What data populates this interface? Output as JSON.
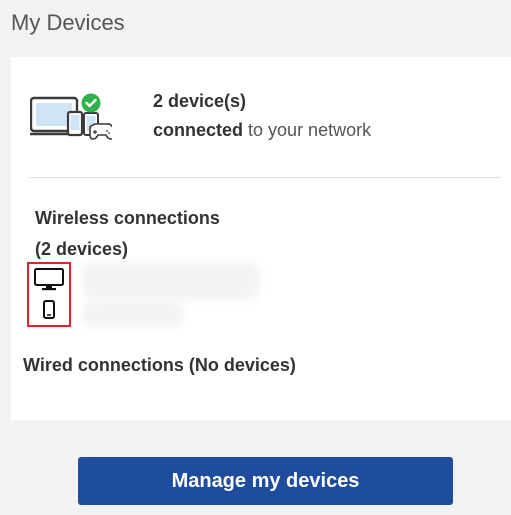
{
  "page_title": "My Devices",
  "summary": {
    "count_text": "2 device(s)",
    "status_bold": "connected",
    "status_rest": " to your network",
    "illustration_icon": "devices-connected-icon",
    "check_color": "#2eb24a"
  },
  "wireless": {
    "heading_line1": "Wireless connections",
    "heading_line2": "(2 devices)",
    "devices": [
      {
        "icon": "monitor-icon"
      },
      {
        "icon": "phone-icon"
      }
    ],
    "highlight_color": "#d9262c"
  },
  "wired": {
    "heading": "Wired connections (No devices)"
  },
  "manage_button": {
    "label": "Manage my devices",
    "color": "#1f4d9e"
  }
}
